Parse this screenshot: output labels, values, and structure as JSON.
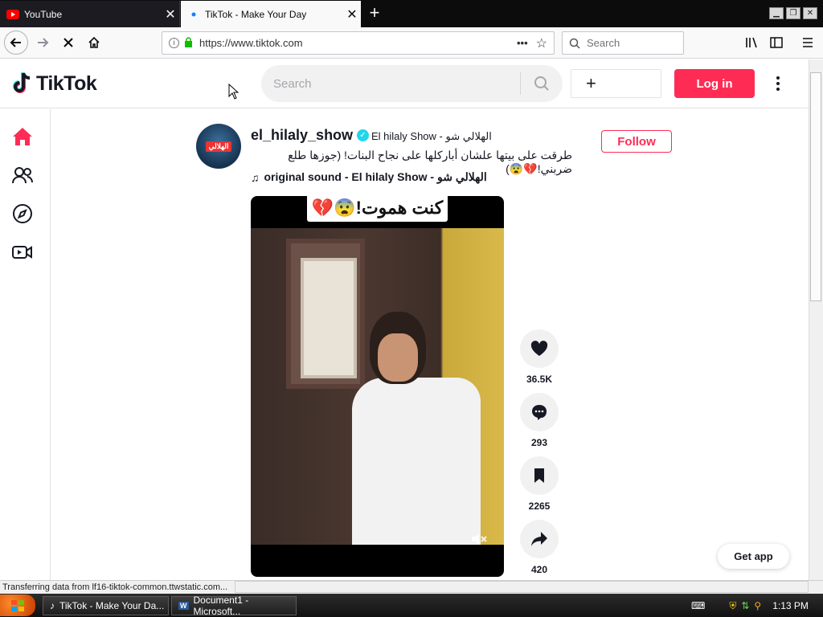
{
  "browser": {
    "tabs": [
      {
        "title": "YouTube",
        "icon": "youtube-icon",
        "active": false
      },
      {
        "title": "TikTok - Make Your Day",
        "icon": "loading-dot-icon",
        "active": true
      }
    ],
    "url": "https://www.tiktok.com",
    "search_placeholder": "Search"
  },
  "tiktok": {
    "logo_text": "TikTok",
    "search_placeholder": "Search",
    "login_label": "Log in",
    "post": {
      "username": "el_hilaly_show",
      "nickname": "El hilaly Show - الهلالي شو",
      "caption": "طرقت على بيتها علشان أباركلها على نجاح البنات! (جوزها طلع ضربني!💔😨)",
      "sound": "original sound - El hilaly Show - الهلالي شو",
      "follow_label": "Follow",
      "video_banner": "كنت هموت!😨💔",
      "avatar_tag": "الهلالي",
      "likes": "36.5K",
      "comments": "293",
      "saves": "2265",
      "shares": "420"
    },
    "get_app_label": "Get app"
  },
  "status_text": "Transferring data from lf16-tiktok-common.ttwstatic.com...",
  "taskbar": {
    "items": [
      {
        "label": "TikTok - Make Your Da..."
      },
      {
        "label": "Document1 - Microsoft..."
      }
    ],
    "clock": "1:13 PM"
  },
  "colors": {
    "brand": "#fe2c55",
    "verified": "#20d5ec"
  }
}
